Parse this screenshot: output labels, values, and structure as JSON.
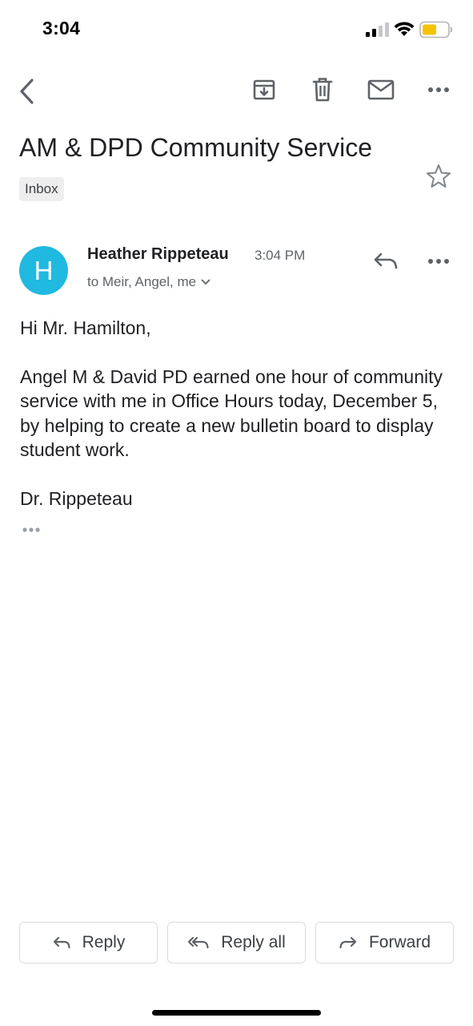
{
  "status_bar": {
    "time": "3:04",
    "icons": [
      "cellular-signal-icon",
      "wifi-icon",
      "battery-icon"
    ],
    "battery_color": "#f5c400"
  },
  "toolbar": {
    "icons": [
      "back-icon",
      "archive-icon",
      "trash-icon",
      "mail-icon",
      "more-icon"
    ]
  },
  "email": {
    "subject": "AM & DPD Community Service",
    "label": "Inbox",
    "sender_initial": "H",
    "avatar_color": "#20b9e0",
    "sender": "Heather Rippeteau",
    "time": "3:04 PM",
    "recipients": "to Meir, Angel, me",
    "body": {
      "greeting": "Hi Mr. Hamilton,",
      "paragraph": "Angel M & David PD earned one hour of community service with me in Office Hours today, December 5, by helping to create a new bulletin board to display student work.",
      "signature": "Dr. Rippeteau"
    }
  },
  "actions": {
    "reply": "Reply",
    "reply_all": "Reply all",
    "forward": "Forward"
  }
}
